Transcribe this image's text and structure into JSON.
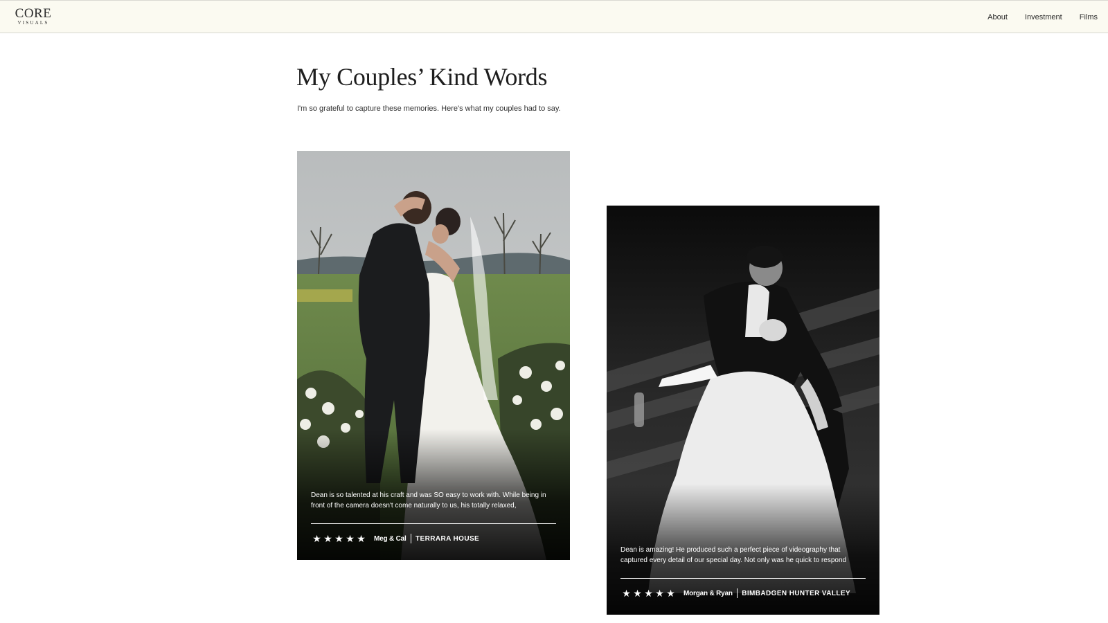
{
  "header": {
    "logo_main": "CORE",
    "logo_sub": "VISUALS",
    "nav": [
      {
        "label": "About"
      },
      {
        "label": "Investment"
      },
      {
        "label": "Films"
      }
    ]
  },
  "intro": {
    "title": "My Couples’ Kind Words",
    "subtitle": "I'm so grateful to capture these memories. Here's what my couples had to say."
  },
  "testimonials": [
    {
      "quote": "Dean is so talented at his craft and was SO easy to work with. While being in front of the camera doesn't come naturally to us, his totally relaxed,",
      "rating": 5,
      "stars": [
        "★",
        "★",
        "★",
        "★",
        "★"
      ],
      "names": "Meg & Cal",
      "venue": "TERRARA HOUSE",
      "photo_icon": "wedding-kiss-photo"
    },
    {
      "quote": "Dean is amazing! He produced such a perfect piece of videography that captured every detail of our special day. Not only was he quick to respond",
      "rating": 5,
      "stars": [
        "★",
        "★",
        "★",
        "★",
        "★"
      ],
      "names": "Morgan & Ryan",
      "venue": "BIMBADGEN HUNTER VALLEY",
      "photo_icon": "black-and-white-couple-photo"
    }
  ],
  "colors": {
    "header_bg": "#fbfaf1",
    "text": "#1e1e1e",
    "overlay_text": "#ffffff"
  }
}
